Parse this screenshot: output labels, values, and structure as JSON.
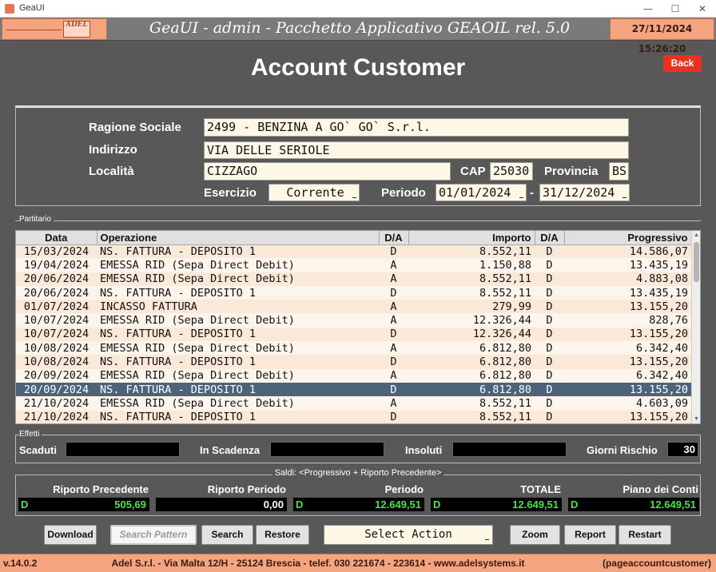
{
  "window": {
    "title": "GeaUI",
    "minimize": "—",
    "maximize": "☐",
    "close": "✕"
  },
  "banner": {
    "logo_text": "ADEL",
    "title": "GeaUI - admin - Pacchetto Applicativo GEAOIL rel. 5.0",
    "datetime": "27/11/2024 15:26:20"
  },
  "page": {
    "title": "Account Customer",
    "back_label": "Back"
  },
  "customer": {
    "ragione_sociale_label": "Ragione Sociale",
    "ragione_sociale": "2499 - BENZINA A GO` GO` S.r.l.",
    "indirizzo_label": "Indirizzo",
    "indirizzo": "VIA DELLE SERIOLE",
    "localita_label": "Località",
    "localita": "CIZZAGO",
    "cap_label": "CAP",
    "cap": "25030",
    "provincia_label": "Provincia",
    "provincia": "BS",
    "esercizio_label": "Esercizio",
    "esercizio": "Corrente",
    "periodo_label": "Periodo",
    "periodo_da": "01/01/2024",
    "periodo_sep": "-",
    "periodo_a": "31/12/2024"
  },
  "partitario": {
    "legend": "Partitario",
    "columns": [
      "Data",
      "Operazione",
      "D/A",
      "Importo",
      "D/A",
      "Progressivo"
    ],
    "rows": [
      [
        "15/03/2024",
        "NS. FATTURA - DEPOSITO 1",
        "D",
        "8.552,11",
        "D",
        "14.586,07"
      ],
      [
        "19/04/2024",
        "EMESSA RID (Sepa Direct Debit)",
        "A",
        "1.150,88",
        "D",
        "13.435,19"
      ],
      [
        "20/06/2024",
        "EMESSA RID (Sepa Direct Debit)",
        "A",
        "8.552,11",
        "D",
        "4.883,08"
      ],
      [
        "20/06/2024",
        "NS. FATTURA - DEPOSITO 1",
        "D",
        "8.552,11",
        "D",
        "13.435,19"
      ],
      [
        "01/07/2024",
        "INCASSO FATTURA",
        "A",
        "279,99",
        "D",
        "13.155,20"
      ],
      [
        "10/07/2024",
        "EMESSA RID (Sepa Direct Debit)",
        "A",
        "12.326,44",
        "D",
        "828,76"
      ],
      [
        "10/07/2024",
        "NS. FATTURA - DEPOSITO 1",
        "D",
        "12.326,44",
        "D",
        "13.155,20"
      ],
      [
        "10/08/2024",
        "EMESSA RID (Sepa Direct Debit)",
        "A",
        "6.812,80",
        "D",
        "6.342,40"
      ],
      [
        "10/08/2024",
        "NS. FATTURA - DEPOSITO 1",
        "D",
        "6.812,80",
        "D",
        "13.155,20"
      ],
      [
        "20/09/2024",
        "EMESSA RID (Sepa Direct Debit)",
        "A",
        "6.812,80",
        "D",
        "6.342,40"
      ],
      [
        "20/09/2024",
        "NS. FATTURA - DEPOSITO 1",
        "D",
        "6.812,80",
        "D",
        "13.155,20"
      ],
      [
        "21/10/2024",
        "EMESSA RID (Sepa Direct Debit)",
        "A",
        "8.552,11",
        "D",
        "4.603,09"
      ],
      [
        "21/10/2024",
        "NS. FATTURA - DEPOSITO 1",
        "D",
        "8.552,11",
        "D",
        "13.155,20"
      ]
    ],
    "selected_row": 10
  },
  "effetti": {
    "legend": "Effetti",
    "scaduti_label": "Scaduti",
    "in_scadenza_label": "In Scadenza",
    "insoluti_label": "Insoluti",
    "giorni_rischio_label": "Giorni Rischio",
    "giorni_rischio": "30"
  },
  "saldi": {
    "title": "Saldi: <Progressivo + Riporto Precedente>",
    "riporto_precedente_label": "Riporto Precedente",
    "riporto_precedente_da": "D",
    "riporto_precedente": "505,69",
    "riporto_periodo_label": "Riporto Periodo",
    "riporto_periodo": "0,00",
    "periodo_label": "Periodo",
    "periodo_da": "D",
    "periodo": "12.649,51",
    "totale_label": "TOTALE",
    "totale_da": "D",
    "totale": "12.649,51",
    "piano_conti_label": "Piano dei Conti",
    "piano_conti_da": "D",
    "piano_conti": "12.649,51"
  },
  "toolbar": {
    "download": "Download",
    "search_pattern": "Search Pattern",
    "search": "Search",
    "restore": "Restore",
    "select_action": "Select Action",
    "zoom": "Zoom",
    "report": "Report",
    "restart": "Restart"
  },
  "footer": {
    "version": "v.14.0.2",
    "company": "Adel S.r.l. - Via Malta 12/H - 25124 Brescia - telef. 030 221674 - 223614 - www.adelsystems.it",
    "page_id": "(pageaccountcustomer)"
  },
  "colors": {
    "accent": "#f4a57f",
    "background": "#585858",
    "back_button": "#e8321e",
    "selected_row": "#4c637a",
    "value_green": "#4ae34a"
  }
}
